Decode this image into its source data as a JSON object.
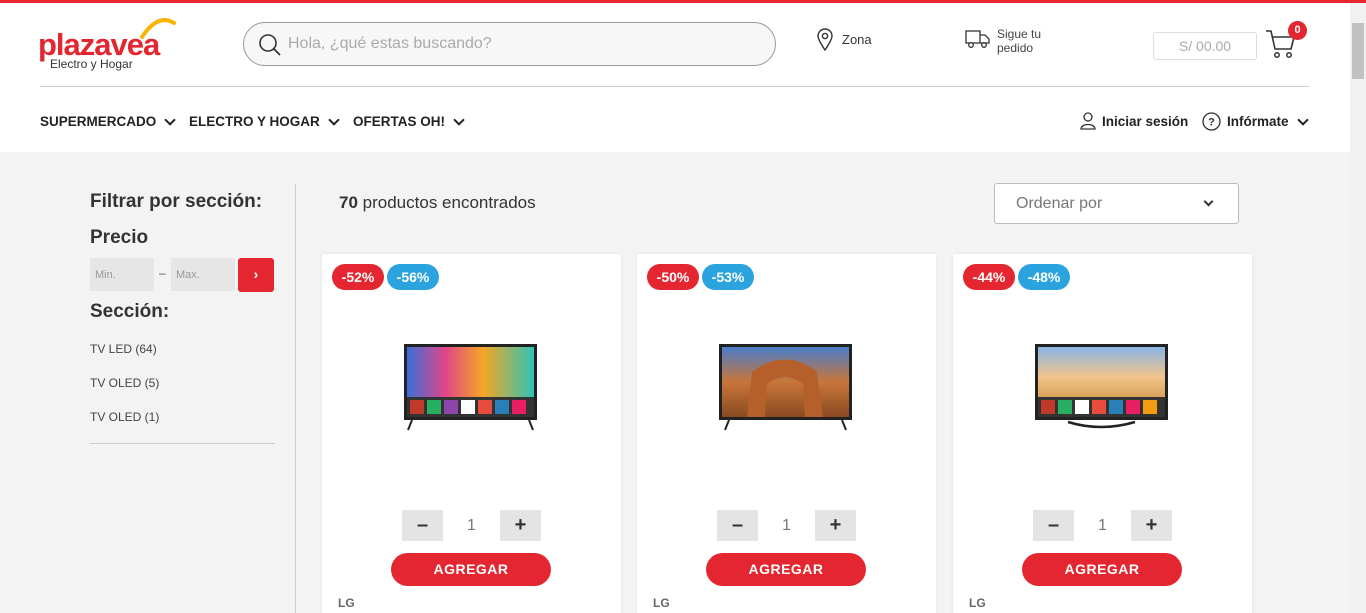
{
  "header": {
    "logo_text": "plazavea",
    "logo_sub": "Electro y Hogar",
    "search_placeholder": "Hola, ¿qué estas buscando?",
    "zona": "Zona",
    "pedido": "Sigue tu pedido",
    "cart_total": "S/ 00.00",
    "cart_count": "0",
    "nav": [
      "SUPERMERCADO",
      "ELECTRO Y HOGAR",
      "OFERTAS OH!"
    ],
    "login": "Iniciar sesión",
    "informate": "Infórmate"
  },
  "sidebar": {
    "filter_title": "Filtrar por sección:",
    "precio_title": "Precio",
    "min_placeholder": "Min.",
    "max_placeholder": "Max.",
    "dash": "–",
    "go": "›",
    "seccion_title": "Sección:",
    "items": [
      "TV LED (64)",
      "TV OLED (5)",
      "TV OLED (1)"
    ]
  },
  "results": {
    "count": "70",
    "count_label": "productos encontrados",
    "sort_placeholder": "Ordenar por"
  },
  "products": [
    {
      "discount_red": "-52%",
      "discount_blue": "-56%",
      "qty": "1",
      "add_label": "AGREGAR",
      "brand": "LG",
      "minus": "–",
      "plus": "+"
    },
    {
      "discount_red": "-50%",
      "discount_blue": "-53%",
      "qty": "1",
      "add_label": "AGREGAR",
      "brand": "LG",
      "minus": "–",
      "plus": "+"
    },
    {
      "discount_red": "-44%",
      "discount_blue": "-48%",
      "qty": "1",
      "add_label": "AGREGAR",
      "brand": "LG",
      "minus": "–",
      "plus": "+"
    }
  ],
  "colors": {
    "accent": "#e3262f",
    "blue": "#2ba3df"
  }
}
